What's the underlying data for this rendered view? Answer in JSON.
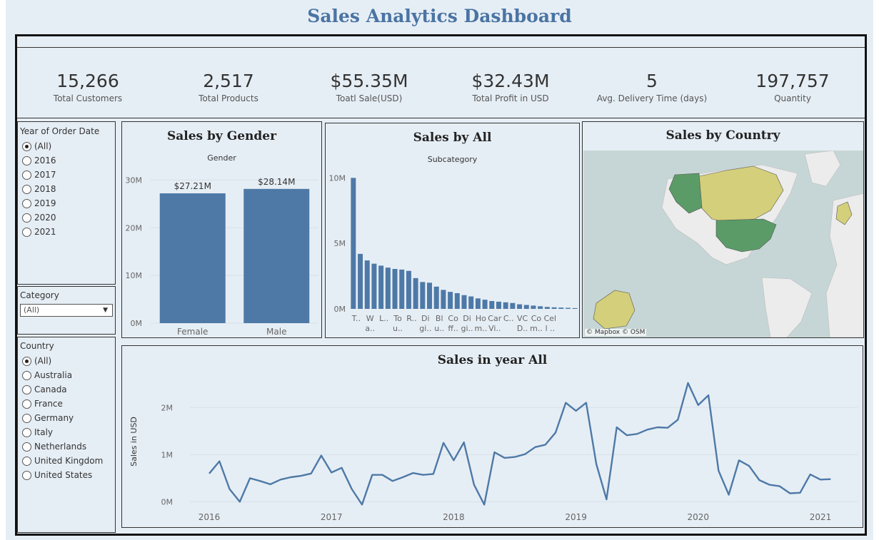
{
  "page": {
    "title": "Sales Analytics Dashboard"
  },
  "kpis": [
    {
      "value": "15,266",
      "label": "Total Customers"
    },
    {
      "value": "2,517",
      "label": "Total Products"
    },
    {
      "value": "$55.35M",
      "label": "Toatl Sale(USD)"
    },
    {
      "value": "$32.43M",
      "label": "Total Profit in USD"
    },
    {
      "value": "5",
      "label": "Avg. Delivery Time (days)"
    },
    {
      "value": "197,757",
      "label": "Quantity"
    }
  ],
  "filters": {
    "year": {
      "title": "Year of Order Date",
      "options": [
        "(All)",
        "2016",
        "2017",
        "2018",
        "2019",
        "2020",
        "2021"
      ],
      "selected": "(All)"
    },
    "category": {
      "title": "Category",
      "value": "(All)"
    },
    "country": {
      "title": "Country",
      "options": [
        "(All)",
        "Australia",
        "Canada",
        "France",
        "Germany",
        "Italy",
        "Netherlands",
        "United Kingdom",
        "United States"
      ],
      "selected": "(All)"
    }
  },
  "map": {
    "title": "Sales by Country",
    "attribution": "© Mapbox  © OSM",
    "colors": {
      "water": "#c6d6d6",
      "land": "#ececec",
      "high": "#5b9b67",
      "low": "#d4cf7a"
    }
  },
  "colors": {
    "bar": "#4e79a7",
    "line": "#4e79a7",
    "title": "#4a74a3"
  },
  "chart_data": [
    {
      "type": "bar",
      "title": "Sales by Gender",
      "subtitle": "Gender",
      "categories": [
        "Female",
        "Male"
      ],
      "values": [
        27.21,
        28.14
      ],
      "data_labels": [
        "$27.21M",
        "$28.14M"
      ],
      "ylim": [
        0,
        32
      ],
      "yticks": [
        0,
        10,
        20,
        30
      ],
      "ytick_labels": [
        "0M",
        "10M",
        "20M",
        "30M"
      ]
    },
    {
      "type": "bar",
      "title": "Sales by All",
      "subtitle": "Subcategory",
      "categories": [
        "T..",
        "W\na..",
        "L..",
        "To\nu..",
        "R..",
        "Di\ngi..",
        "Bl\nu..",
        "Co\nff..",
        "Di\ngi..",
        "Ho\nm..",
        "Car\nVi..",
        "C..",
        "VC\nD..",
        "Co\nm..",
        "Cel\nl .."
      ],
      "values": [
        10.0,
        4.2,
        3.7,
        3.45,
        3.3,
        3.15,
        3.05,
        3.0,
        2.9,
        2.35,
        2.05,
        2.0,
        1.7,
        1.45,
        1.3,
        1.2,
        1.05,
        0.95,
        0.8,
        0.7,
        0.6,
        0.55,
        0.5,
        0.45,
        0.35,
        0.3,
        0.25,
        0.2,
        0.15,
        0.12,
        0.1,
        0.08,
        0.06
      ],
      "ylim": [
        0,
        11
      ],
      "yticks": [
        0,
        5,
        10
      ],
      "ytick_labels": [
        "0M",
        "5M",
        "10M"
      ]
    },
    {
      "type": "line",
      "title": "Sales in  year All",
      "ylabel": "Sales in USD",
      "x_start": "2016-01",
      "x_end": "2021-01",
      "x": [
        "2016-01",
        "2016-02",
        "2016-03",
        "2016-04",
        "2016-05",
        "2016-06",
        "2016-07",
        "2016-08",
        "2016-09",
        "2016-10",
        "2016-11",
        "2016-12",
        "2017-01",
        "2017-02",
        "2017-03",
        "2017-04",
        "2017-05",
        "2017-06",
        "2017-07",
        "2017-08",
        "2017-09",
        "2017-10",
        "2017-11",
        "2017-12",
        "2018-01",
        "2018-02",
        "2018-03",
        "2018-04",
        "2018-05",
        "2018-06",
        "2018-07",
        "2018-08",
        "2018-09",
        "2018-10",
        "2018-11",
        "2018-12",
        "2019-01",
        "2019-02",
        "2019-03",
        "2019-04",
        "2019-05",
        "2019-06",
        "2019-07",
        "2019-08",
        "2019-09",
        "2019-10",
        "2019-11",
        "2019-12",
        "2020-01",
        "2020-02",
        "2020-03",
        "2020-04",
        "2020-05",
        "2020-06",
        "2020-07",
        "2020-08",
        "2020-09",
        "2020-10",
        "2020-11",
        "2020-12",
        "2021-01"
      ],
      "values": [
        0.6,
        0.86,
        0.27,
        0.0,
        0.5,
        0.44,
        0.37,
        0.47,
        0.52,
        0.55,
        0.6,
        0.98,
        0.62,
        0.72,
        0.27,
        -0.06,
        0.57,
        0.57,
        0.44,
        0.52,
        0.61,
        0.57,
        0.59,
        1.25,
        0.88,
        1.26,
        0.36,
        -0.06,
        1.05,
        0.93,
        0.95,
        1.01,
        1.16,
        1.21,
        1.47,
        2.1,
        1.93,
        2.1,
        0.8,
        0.05,
        1.58,
        1.41,
        1.44,
        1.53,
        1.58,
        1.57,
        1.74,
        2.52,
        2.05,
        2.26,
        0.66,
        0.15,
        0.88,
        0.76,
        0.46,
        0.36,
        0.33,
        0.18,
        0.19,
        0.58,
        0.47,
        0.48
      ],
      "ylim": [
        -0.1,
        2.7
      ],
      "yticks": [
        0,
        1,
        2
      ],
      "ytick_labels": [
        "0M",
        "1M",
        "2M"
      ],
      "xtick_labels": [
        "2016",
        "2017",
        "2018",
        "2019",
        "2020",
        "2021"
      ]
    }
  ]
}
